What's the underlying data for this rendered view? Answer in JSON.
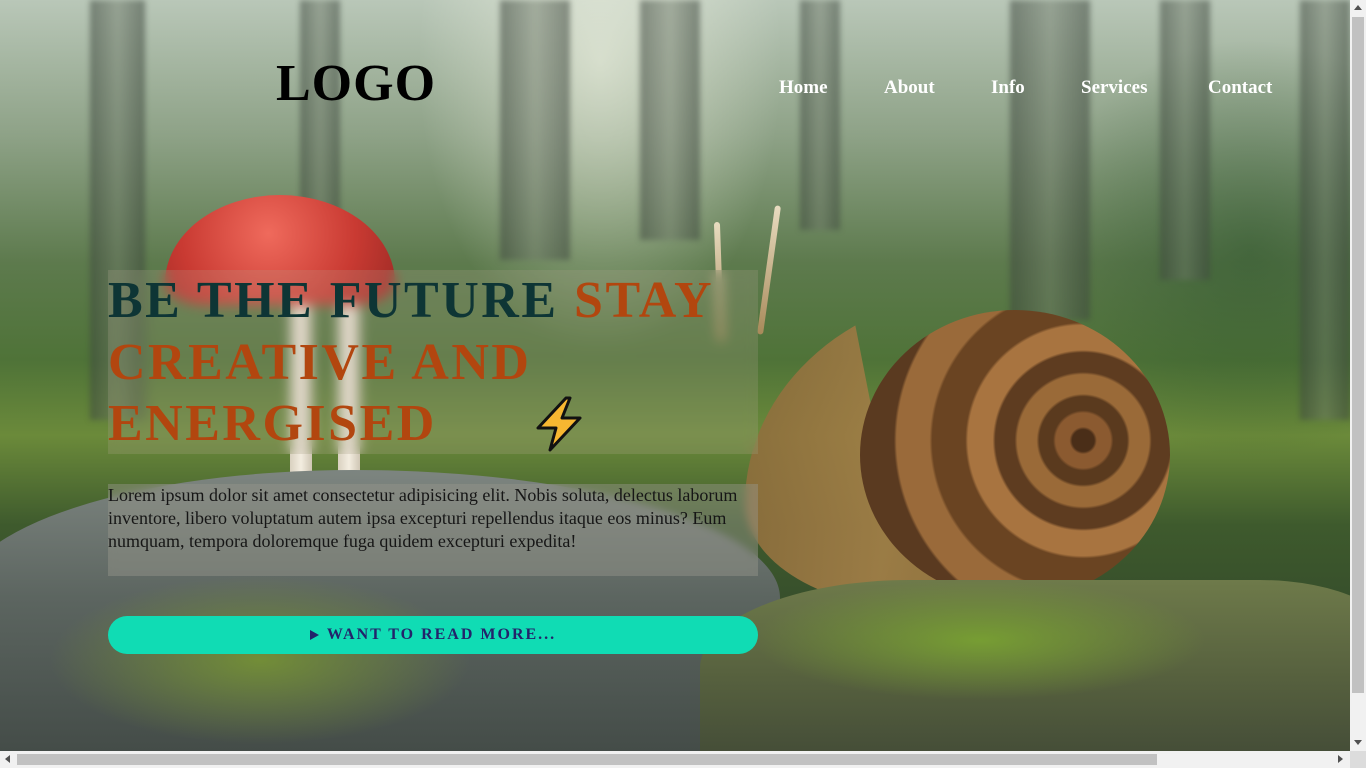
{
  "header": {
    "logo": "LOGO",
    "nav": [
      {
        "label": "Home"
      },
      {
        "label": "About"
      },
      {
        "label": "Info"
      },
      {
        "label": "Services"
      },
      {
        "label": "Contact"
      }
    ]
  },
  "hero": {
    "title_line1_dark": "BE THE FUTURE ",
    "title_line1_accent": "STAY",
    "title_line2": "CREATIVE AND",
    "title_line3": "ENERGISED",
    "title_icon": "lightning-bolt-icon",
    "description": "Lorem ipsum dolor sit amet consectetur adipisicing elit. Nobis soluta, delectus laborum inventore, libero voluptatum autem ipsa excepturi repellendus itaque eos minus? Eum numquam, tempora doloremque fuga quidem excepturi expedita!",
    "cta_label": "WANT TO READ MORE...",
    "cta_icon": "play-triangle-icon"
  },
  "colors": {
    "title_dark": "#0e3535",
    "title_accent": "#b2460f",
    "cta_background": "#10dcb4",
    "cta_text": "#23236a",
    "nav_text": "#ffffff",
    "bolt_fill": "#f7b731"
  },
  "background": {
    "icon": "forest-snail-mushroom-image"
  }
}
